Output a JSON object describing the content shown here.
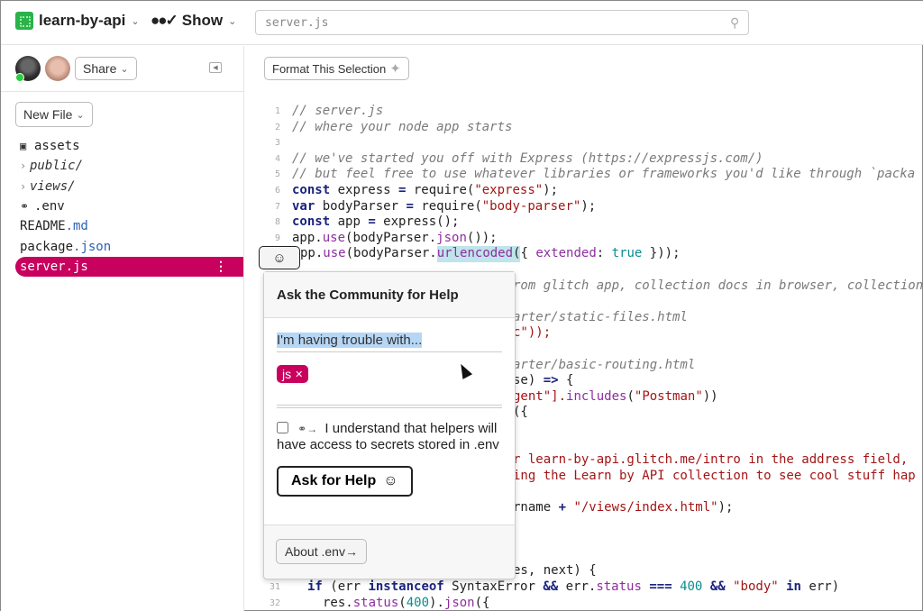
{
  "topbar": {
    "project_name": "learn-by-api",
    "show_label": "Show",
    "search_value": "server.js"
  },
  "sidebar": {
    "share_label": "Share",
    "new_file_label": "New File",
    "files": [
      {
        "name": "assets",
        "type": "assets"
      },
      {
        "name": "public/",
        "type": "folder"
      },
      {
        "name": "views/",
        "type": "folder"
      },
      {
        "name": ".env",
        "type": "env"
      },
      {
        "name": "README",
        "ext": ".md",
        "type": "file"
      },
      {
        "name": "package",
        "ext": ".json",
        "type": "file"
      },
      {
        "name": "server.js",
        "type": "file",
        "active": true
      }
    ],
    "active_color": "#c8005e"
  },
  "editor": {
    "format_label": "Format This Selection",
    "line_numbers": [
      "1",
      "2",
      "3",
      "4",
      "5",
      "6",
      "7",
      "8",
      "9",
      "31",
      "32"
    ],
    "lines": {
      "l1": "// server.js",
      "l2": "// where your node app starts",
      "l4": "// we've started you off with Express (https://expressjs.com/)",
      "l5": "// but feel free to use whatever libraries or frameworks you'd like through `packa",
      "l6": [
        "const",
        " express ",
        "=",
        " require(",
        "\"express\"",
        ");"
      ],
      "l7": [
        "var",
        " bodyParser ",
        "=",
        " require(",
        "\"body-parser\"",
        ");"
      ],
      "l8": [
        "const",
        " app ",
        "=",
        " express();"
      ],
      "l9": [
        "app.",
        "use",
        "(bodyParser.",
        "json",
        "());"
      ],
      "l10": [
        "pp.",
        "use",
        "(bodyParser.",
        "urlencoded",
        "(",
        "{ ",
        "extended",
        ": ",
        "true",
        " }));"
      ],
      "l12": "rom glitch app, collection docs in browser, collection",
      "l14": "arter/static-files.html",
      "l15": "c\"));",
      "l17": "arter/basic-routing.html",
      "l18": [
        "se) ",
        "=>",
        " {"
      ],
      "l19": [
        "gent\"].",
        "includes",
        "(",
        "\"Postman\"",
        "))"
      ],
      "l20": "({",
      "l23": "r learn-by-api.glitch.me/intro in the address field,",
      "l24": "ing the Learn by API collection to see cool stuff hap",
      "l26": [
        "rname ",
        "+",
        " \"/views/index.html\"",
        ");"
      ],
      "l30": "es, next) {",
      "l31": [
        "if",
        " (err ",
        "instanceof",
        " SyntaxError ",
        "&&",
        " err.",
        "status",
        " ",
        "===",
        " ",
        "400",
        " ",
        "&&",
        " ",
        "\"body\"",
        " ",
        "in",
        " err)"
      ],
      "l32": [
        "res.",
        "status",
        "(",
        "400",
        ").",
        "json",
        "({"
      ]
    }
  },
  "help_popover": {
    "title": "Ask the Community for Help",
    "trouble_placeholder": "I'm having trouble with...",
    "tag": "js",
    "consent_text": "I understand that helpers will have access to secrets stored in .env",
    "consent_checked": false,
    "ask_button": "Ask for Help",
    "about_button": "About .env→"
  }
}
